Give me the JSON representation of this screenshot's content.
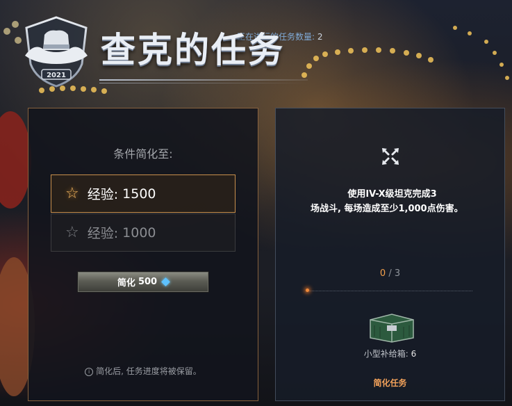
{
  "header": {
    "title": "查克的任务",
    "emblem_year": "2021",
    "active_missions_label": "正在进行的任务数量:",
    "active_missions_count": "2"
  },
  "left_panel": {
    "condition_title": "条件简化至:",
    "options": [
      {
        "label": "经验:",
        "value": "1500",
        "selected": true
      },
      {
        "label": "经验:",
        "value": "1000",
        "selected": false
      }
    ],
    "simplify_button": {
      "label": "简化",
      "cost": "500",
      "currency_icon": "gem-icon"
    },
    "note": "简化后, 任务进度将被保留。"
  },
  "right_panel": {
    "task_icon": "crossed-arrows-icon",
    "task_line1": "使用IV-X级坦克完成3",
    "task_line2": "场战斗, 每场造成至少1,000点伤害。",
    "progress_current": "0",
    "progress_total": "/ 3",
    "progress_fraction": 0.0,
    "reward_label": "小型补给箱:",
    "reward_count": "6",
    "simplify_task_label": "简化任务"
  },
  "colors": {
    "accent_orange": "#f3a25a",
    "panel_border": "#c9904c",
    "gem_blue": "#5ec2ff"
  }
}
